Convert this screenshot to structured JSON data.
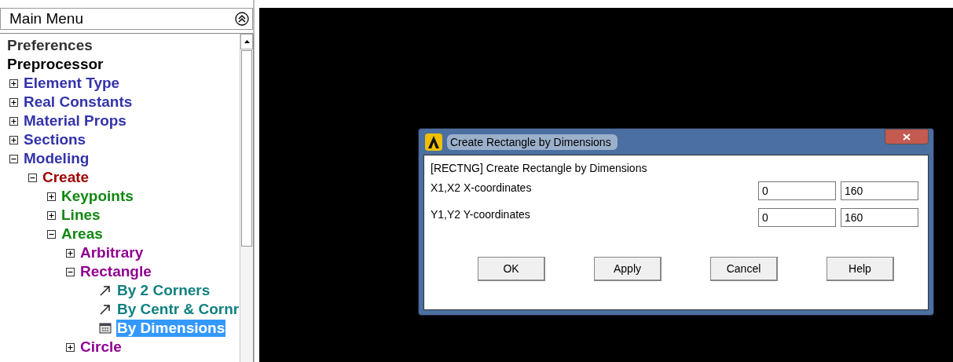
{
  "main_menu": {
    "title": "Main Menu",
    "tree": [
      {
        "label": "Preferences",
        "color": "#333333",
        "selected": false
      },
      {
        "label": "Preprocessor",
        "color": "#000000",
        "selected": false,
        "children": [
          {
            "label": "Element Type",
            "kind": "toggle",
            "expanded": false,
            "color": "#3333aa",
            "selected": false
          },
          {
            "label": "Real Constants",
            "kind": "toggle",
            "expanded": false,
            "color": "#3333aa",
            "selected": false
          },
          {
            "label": "Material Props",
            "kind": "toggle",
            "expanded": false,
            "color": "#3333aa",
            "selected": false
          },
          {
            "label": "Sections",
            "kind": "toggle",
            "expanded": false,
            "color": "#3333aa",
            "selected": false
          },
          {
            "label": "Modeling",
            "kind": "toggle",
            "expanded": true,
            "color": "#3333aa",
            "selected": false,
            "children": [
              {
                "label": "Create",
                "kind": "toggle",
                "expanded": true,
                "color": "#a00000",
                "selected": false,
                "children": [
                  {
                    "label": "Keypoints",
                    "kind": "toggle",
                    "expanded": false,
                    "color": "#118811",
                    "selected": false
                  },
                  {
                    "label": "Lines",
                    "kind": "toggle",
                    "expanded": false,
                    "color": "#118811",
                    "selected": false
                  },
                  {
                    "label": "Areas",
                    "kind": "toggle",
                    "expanded": true,
                    "color": "#118811",
                    "selected": false,
                    "children": [
                      {
                        "label": "Arbitrary",
                        "kind": "toggle",
                        "expanded": false,
                        "color": "#900090",
                        "selected": false
                      },
                      {
                        "label": "Rectangle",
                        "kind": "toggle",
                        "expanded": true,
                        "color": "#900090",
                        "selected": false,
                        "children": [
                          {
                            "label": "By 2 Corners",
                            "kind": "pick",
                            "color": "#118080",
                            "selected": false
                          },
                          {
                            "label": "By Centr & Cornr",
                            "kind": "pick",
                            "color": "#118080",
                            "selected": false
                          },
                          {
                            "label": "By Dimensions",
                            "kind": "dialog",
                            "selected": true
                          }
                        ]
                      },
                      {
                        "label": "Circle",
                        "kind": "toggle",
                        "expanded": false,
                        "color": "#900090",
                        "selected": false
                      }
                    ]
                  }
                ]
              }
            ]
          }
        ]
      }
    ]
  },
  "dialog": {
    "title": "Create Rectangle by Dimensions",
    "heading": "[RECTNG]  Create Rectangle by Dimensions",
    "rows": [
      {
        "label": "X1,X2  X-coordinates",
        "values": [
          "0",
          "160"
        ]
      },
      {
        "label": "Y1,Y2  Y-coordinates",
        "values": [
          "0",
          "160"
        ]
      }
    ],
    "buttons": [
      "OK",
      "Apply",
      "Cancel",
      "Help"
    ]
  }
}
